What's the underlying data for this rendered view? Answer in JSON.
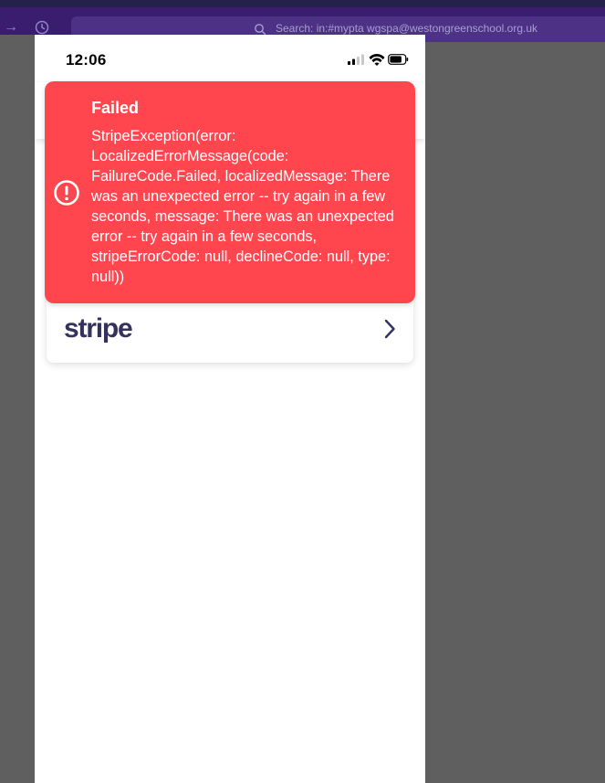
{
  "host": {
    "search_text": "Search: in:#mypta wgspa@westongreenschool.org.uk"
  },
  "status_bar": {
    "time": "12:06"
  },
  "toast": {
    "title": "Failed",
    "message": "StripeException(error: LocalizedErrorMessage(code: FailureCode.Failed, localizedMessage: There was an unexpected error -- try again in a few seconds, message: There was an unexpected error -- try again in a few seconds, stripeErrorCode: null, declineCode: null, type: null))",
    "icon": "exclamation-circle-icon",
    "color": "#ff464e"
  },
  "payment_option": {
    "brand": "stripe",
    "brand_color": "#32325d",
    "icon": "chevron-right-icon"
  }
}
